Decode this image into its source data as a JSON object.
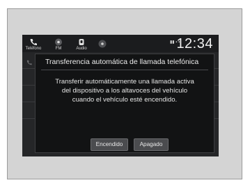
{
  "statusbar": {
    "items": [
      {
        "label": "Teléfono",
        "icon": "phone-icon"
      },
      {
        "label": "FM",
        "icon": "radio-icon"
      },
      {
        "label": "Audio",
        "icon": "audio-icon"
      },
      {
        "label": "",
        "icon": "settings-icon"
      }
    ],
    "signal": "▮▮ ▪ ▪",
    "clock": "12:34"
  },
  "dialog": {
    "title": "Transferencia automática de llamada telefónica",
    "body_lines": [
      "Transferir automáticamente una llamada activa",
      "del dispositivo a los altavoces del vehículo",
      "cuando el vehículo esté encendido."
    ],
    "buttons": {
      "on_label": "Encendido",
      "off_label": "Apagado"
    }
  },
  "colors": {
    "screen_bg": "#252628",
    "dialog_bg": "#121314",
    "button_bg": "#4b4c4f",
    "text": "#ececec"
  }
}
